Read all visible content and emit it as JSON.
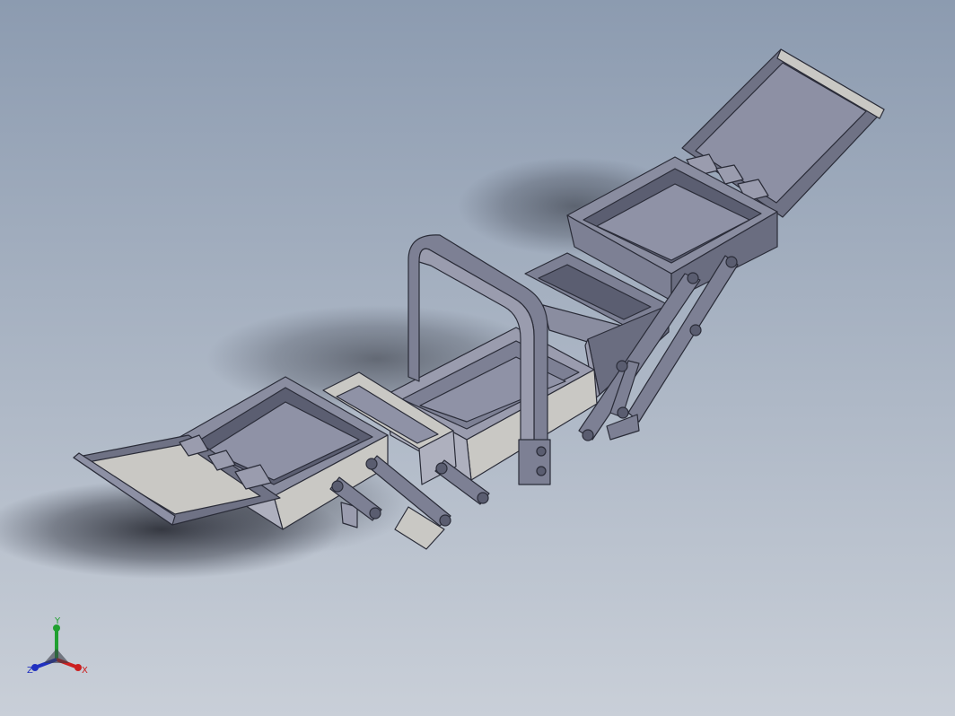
{
  "viewport": {
    "background_top": "#8c9bb0",
    "background_bottom": "#c9cfd8"
  },
  "model": {
    "body_color": "#7f8295",
    "face_light": "#c9c8c4",
    "face_mid": "#9a9cae",
    "face_dark": "#5a5d70",
    "edge_color": "#2a2c38"
  },
  "triad": {
    "x_label": "X",
    "y_label": "Y",
    "z_label": "Z",
    "x_color": "#cc2020",
    "y_color": "#20a030",
    "z_color": "#2030c0"
  }
}
